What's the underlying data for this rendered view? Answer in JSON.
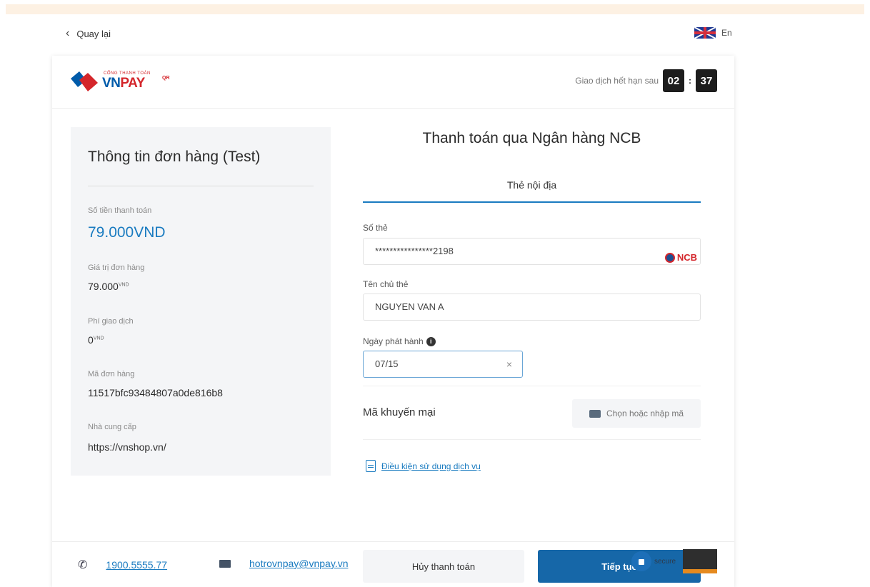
{
  "nav": {
    "back_label": "Quay lại",
    "lang_label": "En"
  },
  "header": {
    "logo_tagline": "CỔNG THANH TOÁN",
    "logo_vn": "VN",
    "logo_pay": "PAY",
    "logo_qr": "QR",
    "timer_label": "Giao dịch hết hạn sau",
    "timer_minutes": "02",
    "timer_seconds": "37"
  },
  "order": {
    "title": "Thông tin đơn hàng (Test)",
    "amount_label": "Số tiền thanh toán",
    "amount_value": "79.000VND",
    "value_label": "Giá trị đơn hàng",
    "value_amount": "79.000",
    "value_currency": "VND",
    "fee_label": "Phí giao dịch",
    "fee_amount": "0",
    "fee_currency": "VND",
    "order_id_label": "Mã đơn hàng",
    "order_id_value": "11517bfc93484807a0de816b8",
    "provider_label": "Nhà cung cấp",
    "provider_value": "https://vnshop.vn/"
  },
  "payment": {
    "title": "Thanh toán qua Ngân hàng NCB",
    "tab_label": "Thẻ nội địa",
    "card_number_label": "Số thẻ",
    "card_number_value": "****************2198",
    "bank_badge": "NCB",
    "holder_label": "Tên chủ thẻ",
    "holder_value": "NGUYEN VAN A",
    "issue_date_label": "Ngày phát hành",
    "issue_date_value": "07/15",
    "promo_label": "Mã khuyến mại",
    "promo_button": "Chọn hoặc nhập mã",
    "terms_link": "Điều kiện sử dụng dịch vụ",
    "cancel_button": "Hủy thanh toán",
    "continue_button": "Tiếp tục"
  },
  "footer": {
    "phone": "1900.5555.77",
    "email": "hotrovnpay@vnpay.vn",
    "secure_label": "secure"
  }
}
